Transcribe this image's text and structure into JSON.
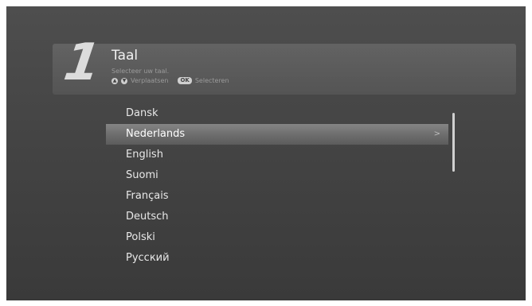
{
  "header": {
    "step": "1",
    "title": "Taal",
    "subtitle": "Selecteer uw taal.",
    "hint_move": "Verplaatsen",
    "hint_ok_key": "OK",
    "hint_select": "Selecteren"
  },
  "languages": [
    {
      "label": "Dansk",
      "selected": false
    },
    {
      "label": "Nederlands",
      "selected": true
    },
    {
      "label": "English",
      "selected": false
    },
    {
      "label": "Suomi",
      "selected": false
    },
    {
      "label": "Français",
      "selected": false
    },
    {
      "label": "Deutsch",
      "selected": false
    },
    {
      "label": "Polski",
      "selected": false
    },
    {
      "label": "Русский",
      "selected": false
    }
  ],
  "selected_arrow": ">",
  "icons": {
    "up": "arrow-up-icon",
    "down": "arrow-down-icon",
    "ok": "ok-button-icon"
  }
}
